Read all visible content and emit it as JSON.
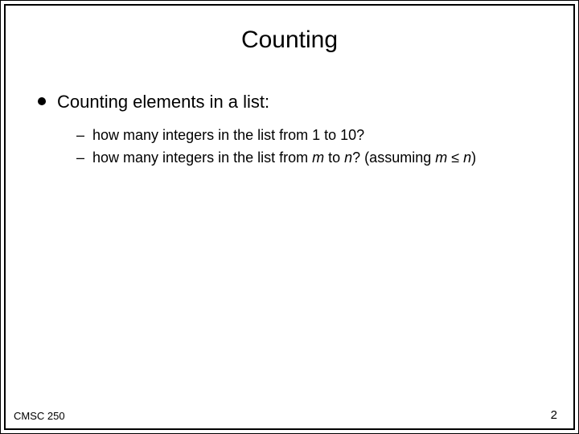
{
  "title": "Counting",
  "bullet": "Counting elements in a list:",
  "sub1": "how many integers in the list from 1 to 10?",
  "sub2_pre": "how many integers in the list from ",
  "sub2_m": "m",
  "sub2_mid1": " to ",
  "sub2_n": "n",
  "sub2_mid2": "?  (assuming ",
  "sub2_m2": "m",
  "sub2_le": " ≤ ",
  "sub2_n2": "n",
  "sub2_post": ")",
  "footer_left": "CMSC 250",
  "footer_right": "2"
}
